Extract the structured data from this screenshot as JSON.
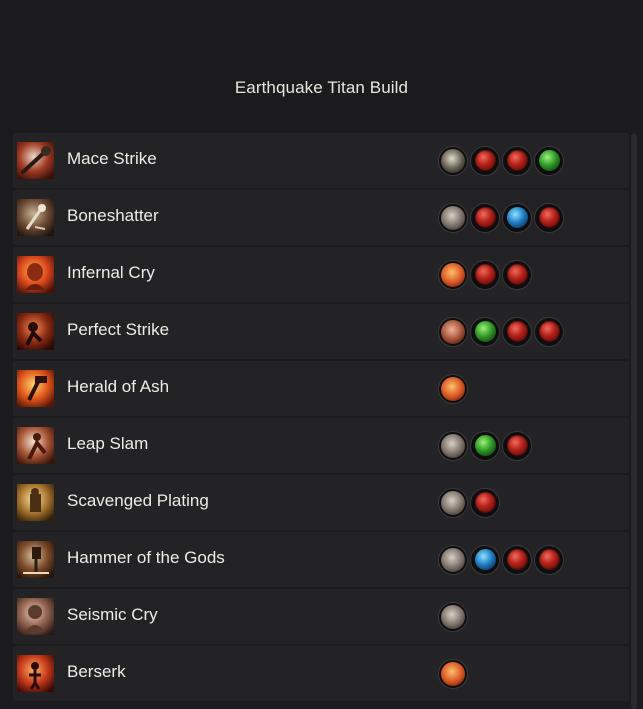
{
  "title": "Earthquake Titan Build",
  "skills": [
    {
      "name": "Mace Strike",
      "icon": "mace-strike-icon",
      "gems": [
        "main-dark",
        "red",
        "red",
        "green"
      ]
    },
    {
      "name": "Boneshatter",
      "icon": "boneshatter-icon",
      "gems": [
        "main-grey",
        "red",
        "blue",
        "red"
      ]
    },
    {
      "name": "Infernal Cry",
      "icon": "infernal-cry-icon",
      "gems": [
        "main-fire",
        "red",
        "red"
      ]
    },
    {
      "name": "Perfect Strike",
      "icon": "perfect-strike-icon",
      "gems": [
        "main-flesh",
        "green",
        "red",
        "red"
      ]
    },
    {
      "name": "Herald of Ash",
      "icon": "herald-of-ash-icon",
      "gems": [
        "main-fire"
      ]
    },
    {
      "name": "Leap Slam",
      "icon": "leap-slam-icon",
      "gems": [
        "main-grey",
        "green",
        "red"
      ]
    },
    {
      "name": "Scavenged Plating",
      "icon": "scavenged-plating-icon",
      "gems": [
        "main-grey",
        "red"
      ]
    },
    {
      "name": "Hammer of the Gods",
      "icon": "hammer-of-the-gods-icon",
      "gems": [
        "main-grey",
        "blue",
        "red",
        "red"
      ]
    },
    {
      "name": "Seismic Cry",
      "icon": "seismic-cry-icon",
      "gems": [
        "main-grey"
      ]
    },
    {
      "name": "Berserk",
      "icon": "berserk-icon",
      "gems": [
        "main-fire"
      ]
    }
  ],
  "colors": {
    "background": "#1b1b1d",
    "row": "#232325",
    "text": "#efece6",
    "red_gem": "#b5221b",
    "green_gem": "#2f9a27",
    "blue_gem": "#1f7fc4"
  }
}
